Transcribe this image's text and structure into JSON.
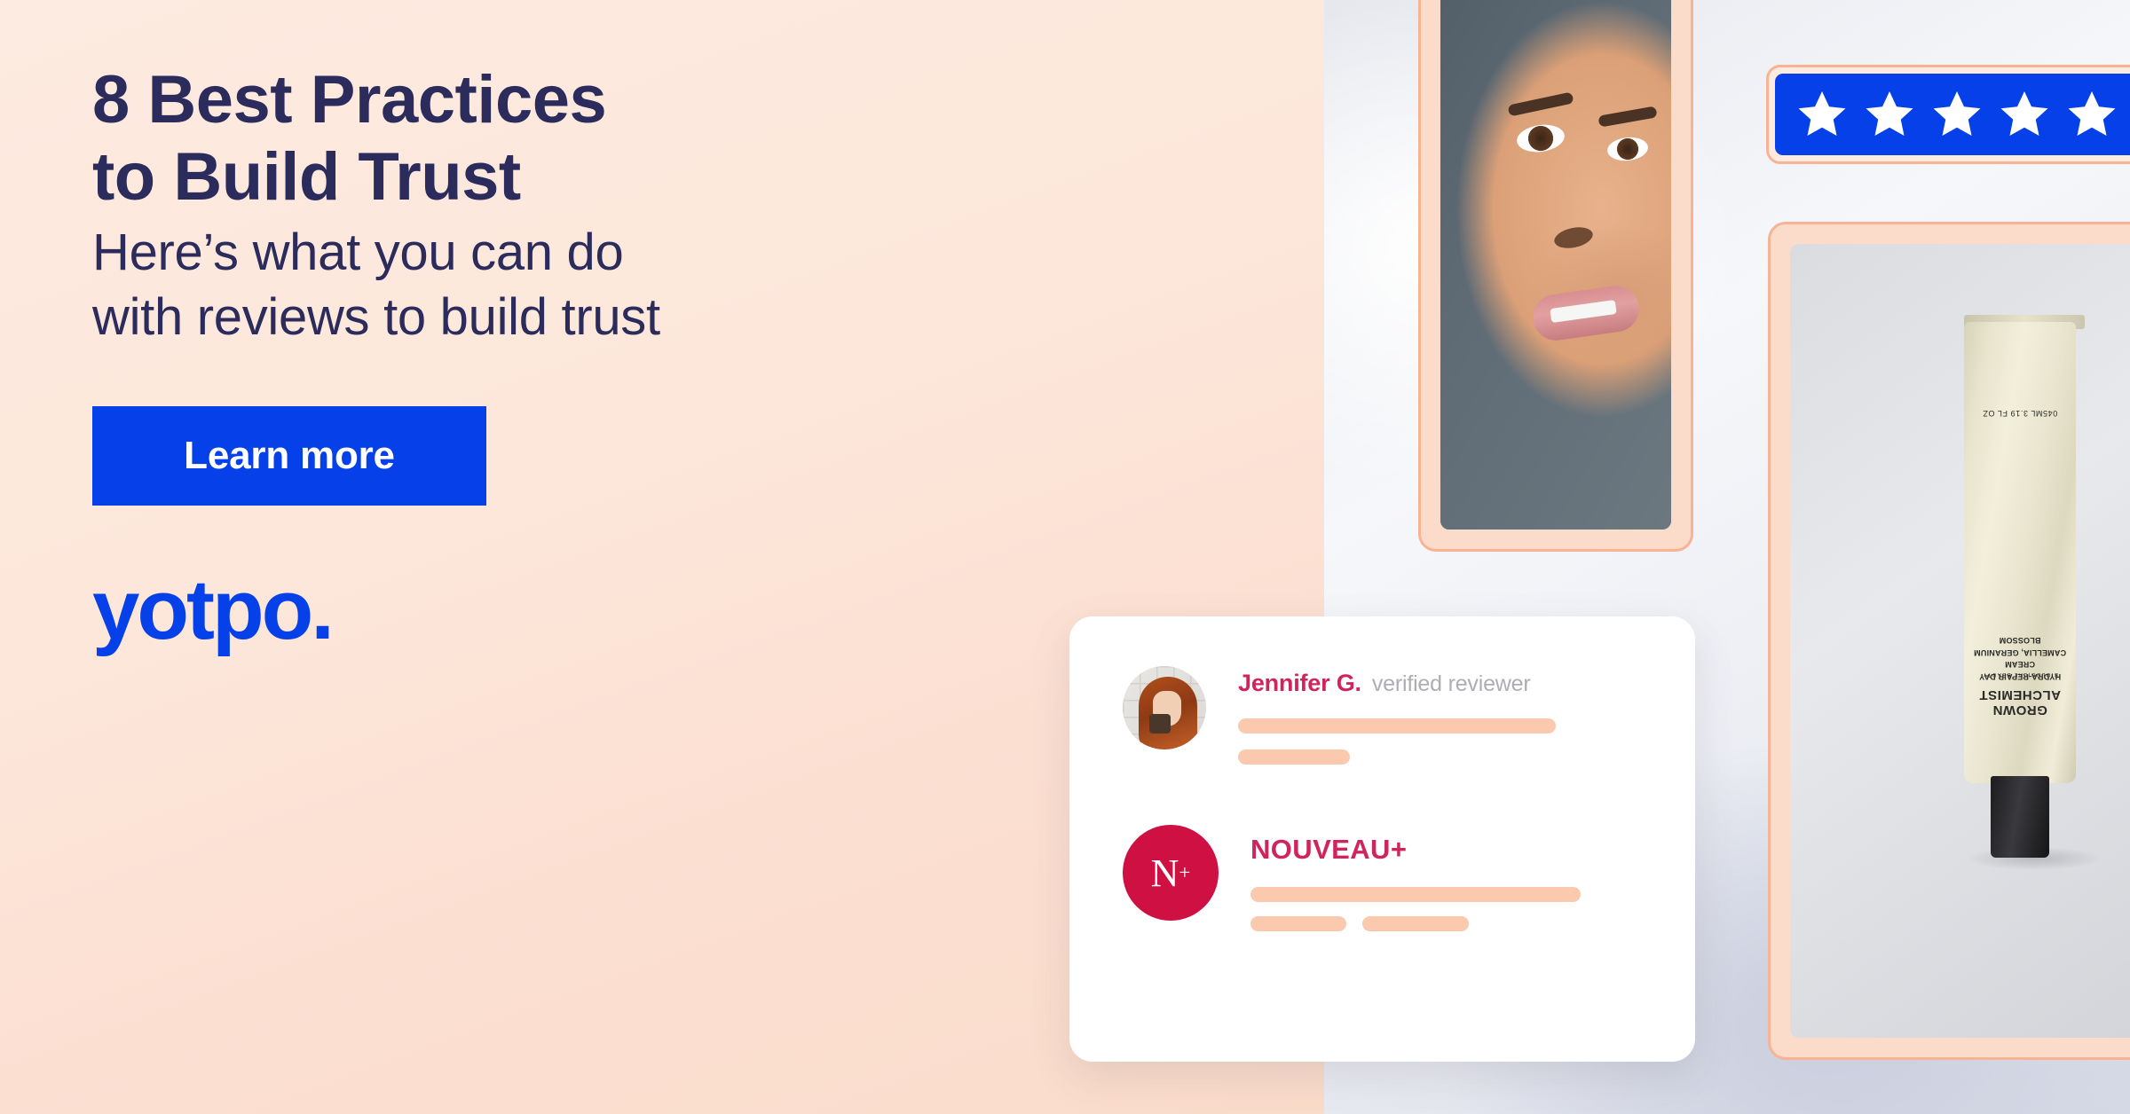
{
  "banner": {
    "headline_line1": "8 Best Practices",
    "headline_line2": "to Build Trust",
    "subhead_line1": "Here’s what you can do",
    "subhead_line2": "with reviews to build trust",
    "cta_label": "Learn more",
    "logo_text": "yotpo.",
    "colors": {
      "navy": "#2B2B5C",
      "blue": "#0540E8",
      "peach_bg": "#FDE9DF",
      "peach_frame": "#FBDCCB",
      "peach_border": "#F7B394",
      "crimson": "#D0245C",
      "brand_red": "#CE1042",
      "bar_peach": "#FBC9AE",
      "gray_text": "#ADADB5"
    }
  },
  "star_badge": {
    "star_count": 5,
    "icon": "star-icon",
    "rating": 5
  },
  "review_card": {
    "reviewer_name": "Jennifer G.",
    "verified_label": "verified reviewer",
    "avatar_icon": "reviewer-avatar",
    "brand_monogram": "N",
    "brand_monogram_sup": "+",
    "brand_name": "NOUVEAU+"
  },
  "product": {
    "brand": "GROWN ALCHEMIST",
    "tagline": "BIOLOGICAL BEAUTY",
    "product_name": "HYDRA-REPAIR DAY CREAM",
    "ingredients": "CAMELLIA, GERANIUM BLOSSOM",
    "volume": "045ML 3.19 FL OZ"
  },
  "portrait": {
    "alt_name": "model-portrait"
  }
}
